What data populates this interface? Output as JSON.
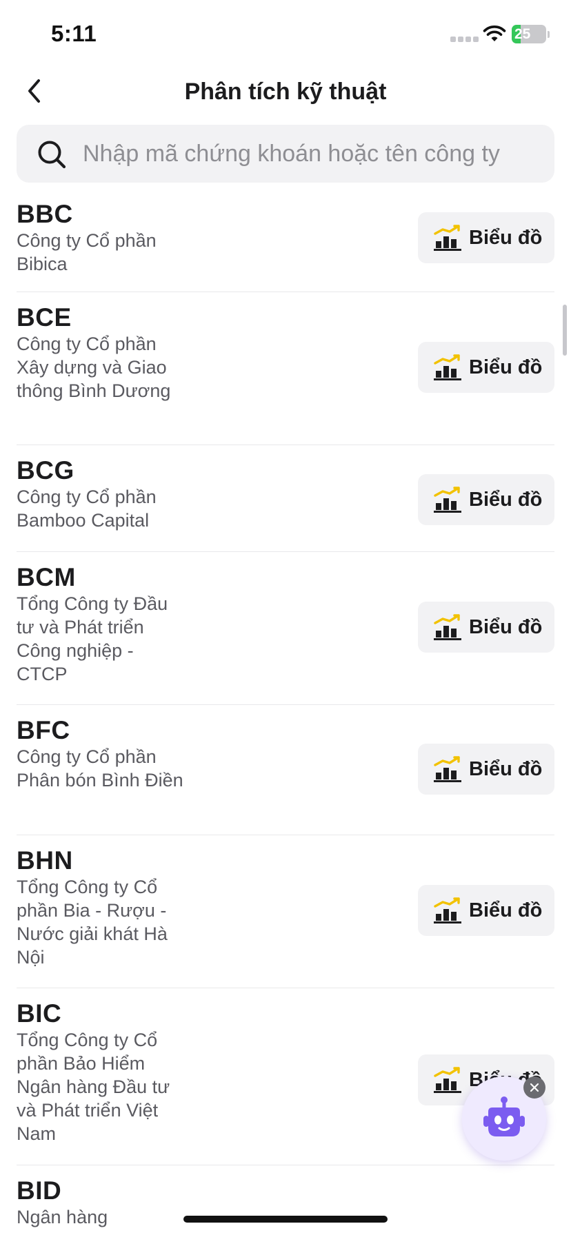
{
  "status_bar": {
    "time": "5:11",
    "battery": "25",
    "battery_level": 0.25
  },
  "header": {
    "title": "Phân tích kỹ thuật",
    "back_icon": "chevron-left-icon"
  },
  "search": {
    "placeholder": "Nhập mã chứng khoán hoặc tên công ty",
    "value": ""
  },
  "stocks": [
    {
      "code": "BBC",
      "name": "Công ty Cổ phần Bibica",
      "button_label": "Biểu đồ"
    },
    {
      "code": "BCE",
      "name": "Công ty Cổ phần Xây dựng và Giao thông Bình Dương",
      "button_label": "Biểu đồ"
    },
    {
      "code": "BCG",
      "name": "Công ty Cổ phần Bamboo Capital",
      "button_label": "Biểu đồ"
    },
    {
      "code": "BCM",
      "name": "Tổng Công ty Đầu tư và Phát triển Công nghiệp - CTCP",
      "button_label": "Biểu đồ"
    },
    {
      "code": "BFC",
      "name": "Công ty Cổ phần Phân bón Bình Điền",
      "button_label": "Biểu đồ"
    },
    {
      "code": "BHN",
      "name": "Tổng Công ty Cổ phần Bia - Rượu - Nước giải khát Hà Nội",
      "button_label": "Biểu đồ"
    },
    {
      "code": "BIC",
      "name": "Tổng Công ty Cổ phần Bảo Hiểm Ngân hàng Đầu tư và Phát triển Việt Nam",
      "button_label": "Biểu đồ"
    },
    {
      "code": "BID",
      "name": "Ngân hàng",
      "button_label": ""
    }
  ],
  "colors": {
    "accent_yellow": "#f2c200",
    "assistant_purple": "#7b5cf0",
    "battery_green": "#34c759"
  }
}
